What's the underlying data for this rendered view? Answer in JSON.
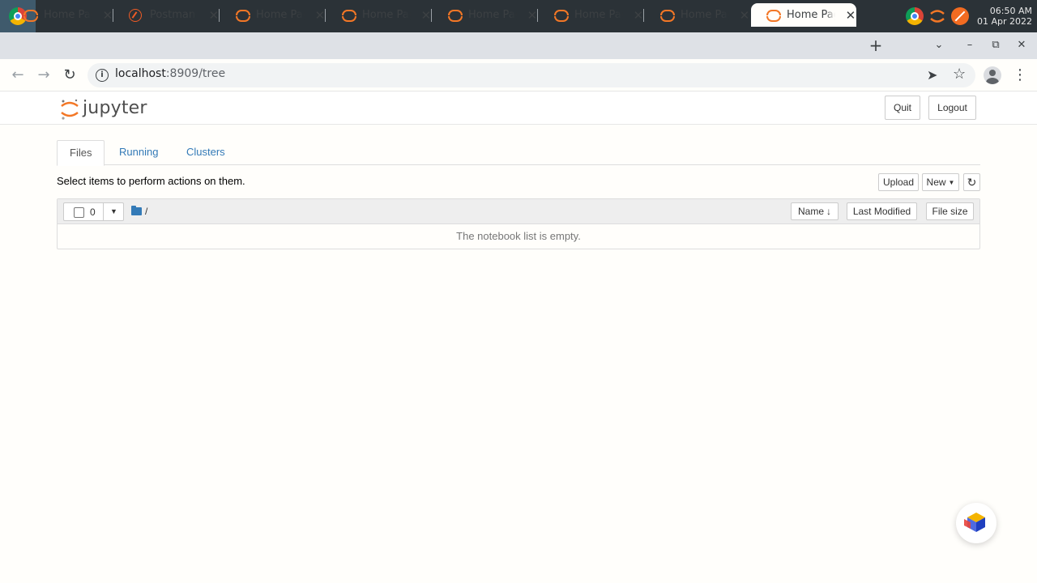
{
  "os": {
    "clock_time": "06:50 AM",
    "clock_date": "01 Apr 2022",
    "tray_icons": [
      "chrome-icon",
      "jupyter-icon",
      "compass-icon"
    ]
  },
  "browser": {
    "tabs": [
      {
        "title": "Home Page",
        "icon": "jupyter-icon",
        "active": false
      },
      {
        "title": "Postman - ",
        "icon": "postman-icon",
        "active": false
      },
      {
        "title": "Home Page",
        "icon": "jupyter-icon",
        "active": false
      },
      {
        "title": "Home Page",
        "icon": "jupyter-icon",
        "active": false
      },
      {
        "title": "Home Page",
        "icon": "jupyter-icon",
        "active": false
      },
      {
        "title": "Home Page",
        "icon": "jupyter-icon",
        "active": false
      },
      {
        "title": "Home Page",
        "icon": "jupyter-icon",
        "active": false
      },
      {
        "title": "Home Page",
        "icon": "jupyter-icon",
        "active": true
      }
    ],
    "url_host": "localhost",
    "url_rest": ":8909/tree"
  },
  "jupyter": {
    "logo_text": "jupyter",
    "quit_label": "Quit",
    "logout_label": "Logout",
    "tabs": [
      "Files",
      "Running",
      "Clusters"
    ],
    "hint": "Select items to perform actions on them.",
    "upload_label": "Upload",
    "new_label": "New",
    "selected_count": "0",
    "breadcrumb": "/",
    "sort_name_label": "Name",
    "sort_modified_label": "Last Modified",
    "sort_size_label": "File size",
    "empty_message": "The notebook list is empty."
  },
  "colors": {
    "jupyter_orange": "#f37726",
    "link_blue": "#337ab7",
    "panel_dark": "#2b3237"
  }
}
